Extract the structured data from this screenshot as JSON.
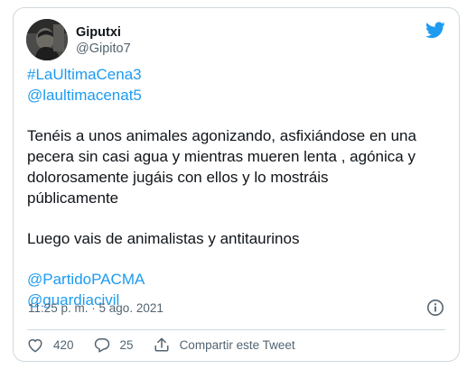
{
  "author": {
    "name": "Giputxi",
    "handle": "@Gipito7"
  },
  "tweet": {
    "lines": [
      {
        "text": "#LaUltimaCena3",
        "link": true
      },
      {
        "text": "@laultimacenat5",
        "link": true
      },
      {
        "text": "",
        "gap": true
      },
      {
        "text": "Tenéis a unos animales agonizando, asfixiándose en una",
        "link": false
      },
      {
        "text": "pecera sin casi agua y mientras mueren lenta , agónica y",
        "link": false
      },
      {
        "text": "dolorosamente jugáis con ellos y lo mostráis",
        "link": false
      },
      {
        "text": "públicamente",
        "link": false
      },
      {
        "text": "",
        "gap": true
      },
      {
        "text": "Luego vais de animalistas y antitaurinos",
        "link": false
      },
      {
        "text": "",
        "gap": true
      },
      {
        "text": "@PartidoPACMA",
        "link": true
      },
      {
        "text": "@guardiacivil",
        "link": true
      }
    ],
    "timestamp": "11:25 p. m. · 5 ago. 2021"
  },
  "actions": {
    "likes": "420",
    "replies": "25",
    "share_label": "Compartir este Tweet"
  },
  "icons": {
    "brand": "twitter-bird-icon",
    "info": "info-icon",
    "like": "heart-icon",
    "reply": "reply-icon",
    "share": "share-icon"
  },
  "colors": {
    "link": "#1d9bf0",
    "text": "#0f1419",
    "muted": "#536471",
    "border": "#cfd9de"
  }
}
